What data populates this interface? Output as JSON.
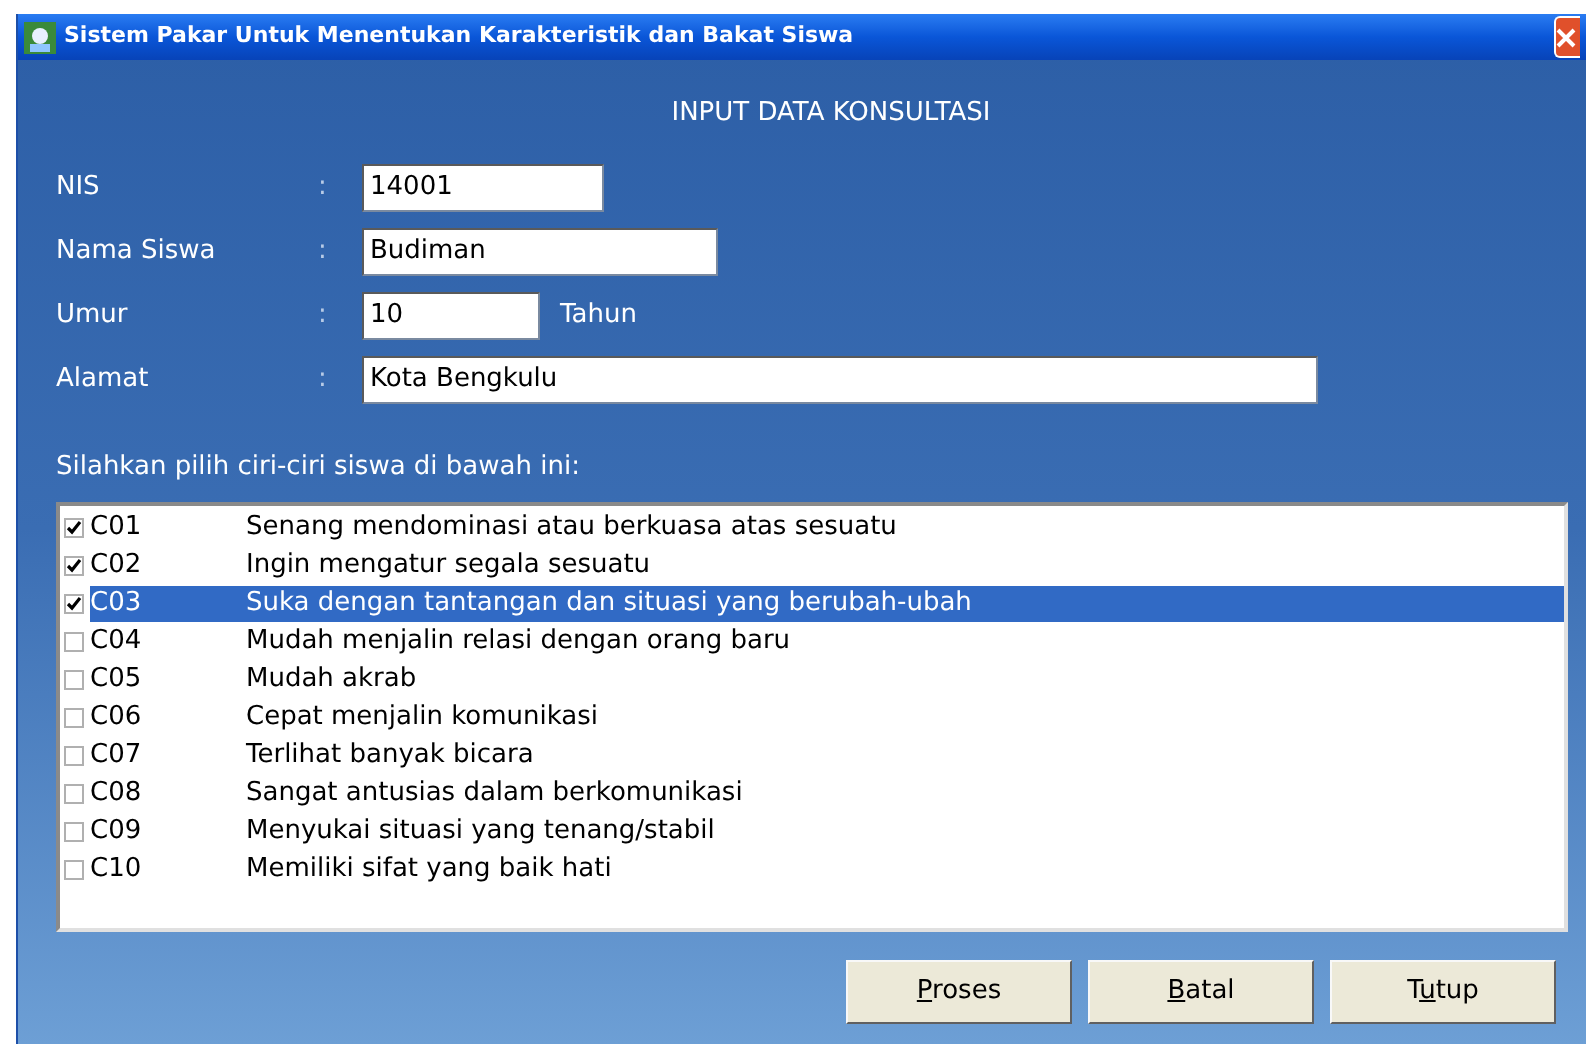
{
  "window": {
    "title": "Sistem Pakar Untuk Menentukan Karakteristik dan Bakat Siswa"
  },
  "heading": "INPUT DATA KONSULTASI",
  "fields": [
    {
      "label": "NIS",
      "separator": ":",
      "value": "14001"
    },
    {
      "label": "Nama Siswa",
      "separator": ":",
      "value": "Budiman"
    },
    {
      "label": "Umur",
      "separator": ":",
      "value": "10",
      "suffix": "Tahun"
    },
    {
      "label": "Alamat",
      "separator": ":",
      "value": "Kota Bengkulu"
    }
  ],
  "list_caption": "Silahkan pilih ciri-ciri siswa di bawah ini:",
  "traits": [
    {
      "code": "C01",
      "text": "Senang mendominasi atau berkuasa atas sesuatu",
      "checked": true,
      "selected": false
    },
    {
      "code": "C02",
      "text": "Ingin mengatur segala sesuatu",
      "checked": true,
      "selected": false
    },
    {
      "code": "C03",
      "text": "Suka dengan tantangan dan situasi yang berubah-ubah",
      "checked": true,
      "selected": true
    },
    {
      "code": "C04",
      "text": "Mudah menjalin relasi dengan orang baru",
      "checked": false,
      "selected": false
    },
    {
      "code": "C05",
      "text": "Mudah akrab",
      "checked": false,
      "selected": false
    },
    {
      "code": "C06",
      "text": "Cepat menjalin komunikasi",
      "checked": false,
      "selected": false
    },
    {
      "code": "C07",
      "text": "Terlihat banyak bicara",
      "checked": false,
      "selected": false
    },
    {
      "code": "C08",
      "text": "Sangat antusias dalam berkomunikasi",
      "checked": false,
      "selected": false
    },
    {
      "code": "C09",
      "text": "Menyukai situasi yang tenang/stabil",
      "checked": false,
      "selected": false
    },
    {
      "code": "C10",
      "text": "Memiliki sifat yang baik hati",
      "checked": false,
      "selected": false
    }
  ],
  "buttons": [
    {
      "key": "P",
      "after": "roses"
    },
    {
      "key": "B",
      "after": "atal"
    },
    {
      "before": "T",
      "key": "u",
      "after": "tup"
    }
  ]
}
